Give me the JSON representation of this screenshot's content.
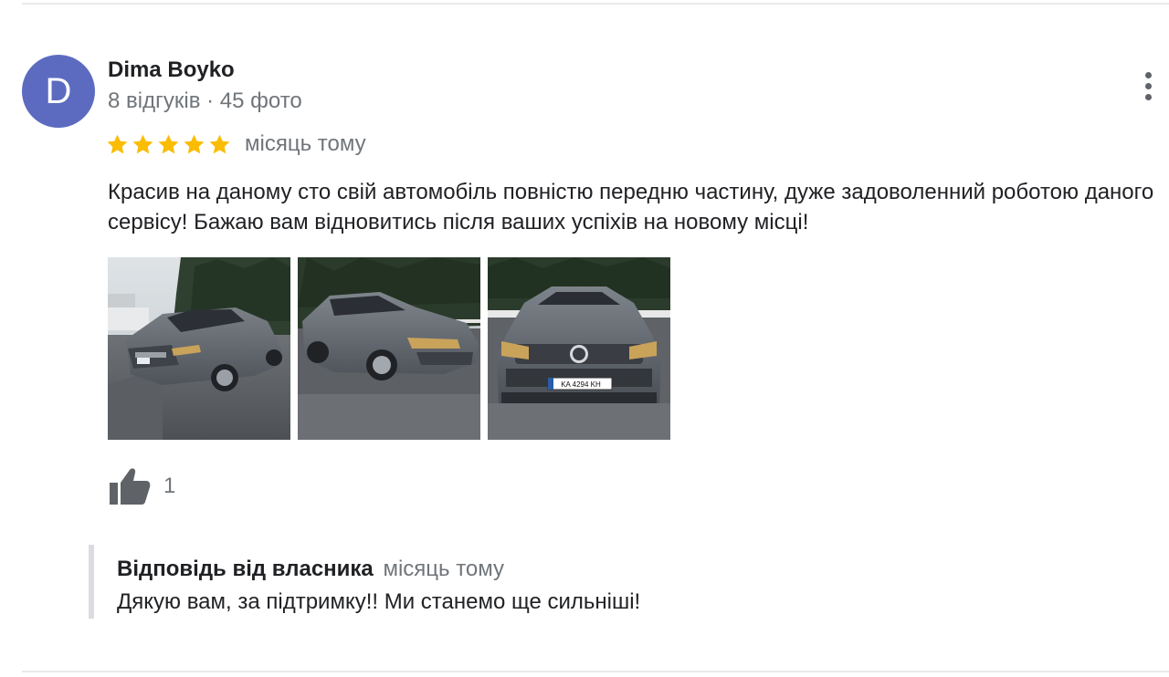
{
  "review": {
    "author": {
      "initial": "D",
      "name": "Dima Boyko",
      "meta": "8 відгуків · 45 фото",
      "avatar_color": "#5c6bc0"
    },
    "menu_icon": "more-vert-icon",
    "rating": 5,
    "rating_max": 5,
    "star_color": "#fbbc04",
    "time": "місяць тому",
    "text": "Красив на даному сто свій автомобіль повністю передню частину, дуже задоволенний роботою даного сервісу! Бажаю вам відновитись після ваших успіхів на новому місці!",
    "photos": [
      {
        "caption": "",
        "plate": ""
      },
      {
        "caption": "",
        "plate": ""
      },
      {
        "caption": "",
        "plate": "KA 4294 KH"
      }
    ],
    "likes": {
      "icon": "thumb-up-icon",
      "count": "1"
    },
    "owner_reply": {
      "title": "Відповідь від власника",
      "time": "місяць тому",
      "text": "Дякую вам, за підтримку!! Ми станемо ще сильніші!"
    }
  }
}
